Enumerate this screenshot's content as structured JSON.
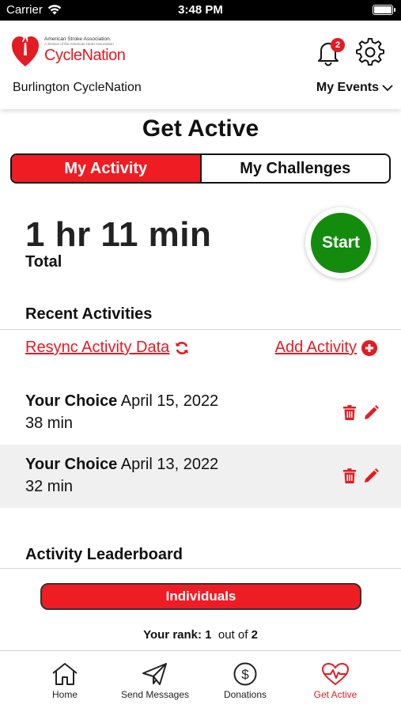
{
  "status_bar": {
    "carrier": "Carrier",
    "time": "3:48 PM"
  },
  "header": {
    "logo_association": "American Stroke Association.",
    "logo_division": "A division of the American Heart Association",
    "logo_brand": "CycleNation",
    "event_name": "Burlington CycleNation",
    "notification_count": "2",
    "my_events_label": "My Events"
  },
  "page": {
    "title": "Get Active"
  },
  "tabs": {
    "my_activity": "My Activity",
    "my_challenges": "My Challenges",
    "active": "my_activity"
  },
  "summary": {
    "total_time": "1 hr 11 min",
    "total_label": "Total",
    "start_label": "Start"
  },
  "recent": {
    "title": "Recent Activities",
    "resync_label": "Resync Activity Data",
    "add_label": "Add Activity",
    "items": [
      {
        "type": "Your Choice",
        "date": "April 15, 2022",
        "duration": "38 min"
      },
      {
        "type": "Your Choice",
        "date": "April 13, 2022",
        "duration": "32 min"
      }
    ]
  },
  "leaderboard": {
    "title": "Activity Leaderboard",
    "individuals_label": "Individuals",
    "rank_label": "Your rank:",
    "rank_value": "1",
    "out_of_label": "out of",
    "total_value": "2"
  },
  "tabbar": {
    "home": "Home",
    "send_messages": "Send Messages",
    "donations": "Donations",
    "get_active": "Get Active",
    "active": "get_active"
  },
  "colors": {
    "brand_red": "#e31b23",
    "start_green": "#138c0d",
    "row_alt": "#f0f0f0"
  }
}
